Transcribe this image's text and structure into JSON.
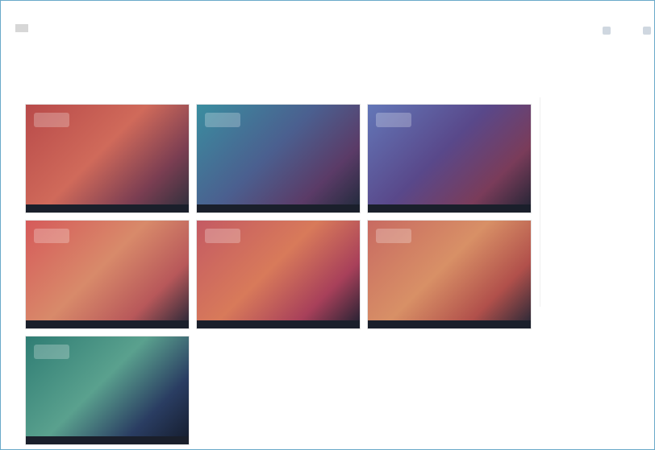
{
  "header": {
    "title": "",
    "top_links": [
      "",
      "",
      ""
    ]
  },
  "nav": {
    "items": [
      "",
      "",
      ""
    ]
  },
  "section": {
    "label": ""
  },
  "grid": {
    "tiles": [
      {
        "caption": "",
        "colors": [
          "#b84a4a",
          "#d06a5a",
          "#7b3e52",
          "#2b2f3b"
        ]
      },
      {
        "caption": "",
        "colors": [
          "#3a8ea0",
          "#4b5f8f",
          "#5b3b67",
          "#1e2a3a"
        ]
      },
      {
        "caption": "",
        "colors": [
          "#6377b8",
          "#59488a",
          "#7a3c5a",
          "#1f2433"
        ]
      },
      {
        "caption": "",
        "colors": [
          "#d65a5a",
          "#d88a6a",
          "#b8585a",
          "#202535"
        ]
      },
      {
        "caption": "",
        "colors": [
          "#c45a63",
          "#d87a5a",
          "#a8405a",
          "#1b2030"
        ]
      },
      {
        "caption": "",
        "colors": [
          "#c86a62",
          "#d89066",
          "#b1504b",
          "#202636"
        ]
      },
      {
        "caption": "",
        "colors": [
          "#2f7d74",
          "#5aa18e",
          "#2a3d62",
          "#141b2b"
        ]
      }
    ]
  },
  "right_panel": {
    "hint": ""
  },
  "below": {
    "lines": [
      "",
      "",
      ""
    ]
  }
}
